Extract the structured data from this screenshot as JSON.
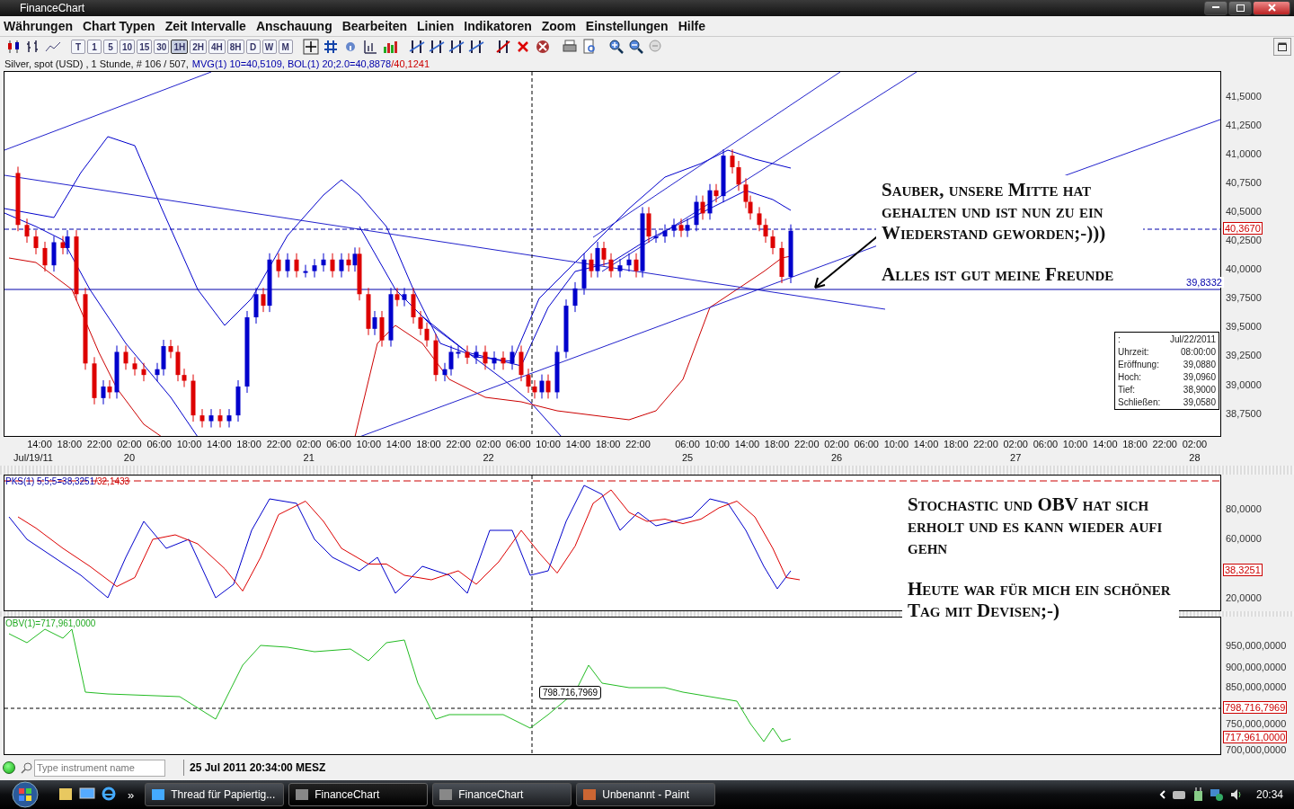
{
  "window": {
    "title": "FinanceChart"
  },
  "menu": [
    "Währungen",
    "Chart Typen",
    "Zeit Intervalle",
    "Anschauung",
    "Bearbeiten",
    "Linien",
    "Indikatoren",
    "Zoom",
    "Einstellungen",
    "Hilfe"
  ],
  "toolbar": {
    "intervals": [
      {
        "label": "T",
        "selected": false
      },
      {
        "label": "1",
        "selected": false
      },
      {
        "label": "5",
        "selected": false
      },
      {
        "label": "10",
        "selected": false
      },
      {
        "label": "15",
        "selected": false
      },
      {
        "label": "30",
        "selected": false
      },
      {
        "label": "1H",
        "selected": true
      },
      {
        "label": "2H",
        "selected": false
      },
      {
        "label": "4H",
        "selected": false
      },
      {
        "label": "8H",
        "selected": false
      },
      {
        "label": "D",
        "selected": false
      },
      {
        "label": "W",
        "selected": false
      },
      {
        "label": "M",
        "selected": false
      }
    ]
  },
  "main_chart": {
    "legend": {
      "instrument": "Silver, spot (USD) , 1 Stunde, # 106 / 507,",
      "indicators": "MVG(1) 10=40,5109, BOL(1) 20;2.0=40,8878",
      "lower_band": "/40,1241"
    },
    "y_ticks": [
      "41,5000",
      "41,2500",
      "41,0000",
      "40,7500",
      "40,5000",
      "40,2500",
      "40,0000",
      "39,7500",
      "39,5000",
      "39,2500",
      "39,0000",
      "38,7500"
    ],
    "markers": [
      {
        "label": "40,3670",
        "kind": "box"
      },
      {
        "label": "39,8332",
        "kind": "inline"
      }
    ],
    "x_ticks": [
      "14:00",
      "18:00",
      "22:00",
      "02:00",
      "06:00",
      "10:00",
      "14:00",
      "18:00",
      "22:00",
      "02:00",
      "06:00",
      "10:00",
      "14:00",
      "18:00",
      "22:00",
      "02:00",
      "06:00",
      "10:00",
      "14:00",
      "18:00",
      "22:00",
      "06:00",
      "10:00",
      "14:00",
      "18:00",
      "22:00",
      "02:00",
      "06:00",
      "10:00",
      "14:00",
      "18:00",
      "22:00",
      "02:00",
      "06:00",
      "10:00",
      "14:00",
      "18:00",
      "22:00",
      "02:00"
    ],
    "dates": [
      "Jul/19/11",
      "20",
      "21",
      "22",
      "25",
      "26",
      "27",
      "28"
    ],
    "info_box": [
      {
        "label": ":",
        "value": "Jul/22/2011"
      },
      {
        "label": "Uhrzeit:",
        "value": "08:00:00"
      },
      {
        "label": "Eröffnung:",
        "value": "39,0880"
      },
      {
        "label": "Hoch:",
        "value": "39,0960"
      },
      {
        "label": "Tief:",
        "value": "38,9000"
      },
      {
        "label": "Schließen:",
        "value": "39,0580"
      }
    ],
    "note": [
      "Sauber, unsere Mitte hat gehalten und ist nun zu ein Wiederstand geworden;-)))",
      "Alles ist gut meine Freunde"
    ]
  },
  "stochastic": {
    "legend": "PKS(1) 5;5;5=38,3251",
    "legend_signal": "/32,1433",
    "y_ticks": [
      "80,0000",
      "60,0000",
      "20,0000"
    ],
    "marker": "38,3251",
    "note": [
      "Stochastic und OBV hat sich erholt und es kann wieder aufi gehn",
      "Heute war für mich ein schöner Tag mit Devisen;-)"
    ]
  },
  "obv": {
    "legend": "OBV(1)=717,961,0000",
    "y_ticks": [
      "950,000,0000",
      "900,000,0000",
      "850,000,0000",
      "750,000,0000",
      "700,000,0000"
    ],
    "markers": [
      "798,716,7969",
      "717,961,0000"
    ],
    "crosshair_label": "798.716,7969"
  },
  "status_bar": {
    "search": {
      "placeholder": "Type instrument name"
    },
    "datetime": "25 Jul 2011 20:34:00 MESZ"
  },
  "taskbar": {
    "overflow": "»",
    "tasks": [
      {
        "label": "Thread für Papiertig...",
        "selected": false
      },
      {
        "label": "FinanceChart",
        "selected": true
      },
      {
        "label": "FinanceChart",
        "selected": false
      },
      {
        "label": "Unbenannt - Paint",
        "selected": false
      }
    ],
    "clock": "20:34"
  }
}
